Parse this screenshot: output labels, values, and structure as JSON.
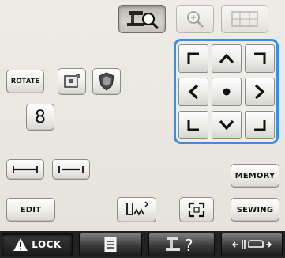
{
  "top_toolbar": {
    "buttons": [
      {
        "name": "preview-scan-button",
        "icon": "machine-magnifier-icon",
        "state": "pressed"
      },
      {
        "name": "zoom-button",
        "icon": "zoom-magnifier-icon",
        "state": "disabled"
      },
      {
        "name": "frame-grid-button",
        "icon": "grid-icon",
        "state": "disabled"
      }
    ]
  },
  "left_tools": {
    "rotate_label": "ROTATE",
    "flip_icon": "flip-mirror-icon",
    "density_icon": "thread-density-icon",
    "size_digit": "8"
  },
  "move_pad": {
    "buttons": [
      "up-left",
      "up",
      "up-right",
      "left",
      "center",
      "right",
      "down-left",
      "down",
      "down-right"
    ]
  },
  "controls": {
    "memory_label": "MEMORY",
    "edit_label": "EDIT",
    "sewing_label": "SEWING",
    "shrink_icon": "shrink-line-icon",
    "stretch_icon": "stretch-line-icon",
    "stitch_icon": "stitch-density-icon",
    "trial_icon": "trial-frame-icon"
  },
  "statusbar": {
    "lock_label": "LOCK",
    "settings_icon": "settings-list-icon",
    "help_icon": "machine-help-icon",
    "presser_icon": "presser-foot-icon"
  },
  "colors": {
    "dpad_border": "#3a8de0",
    "statusbar_bg": "#222222",
    "panel_bg": "#eeece6"
  }
}
